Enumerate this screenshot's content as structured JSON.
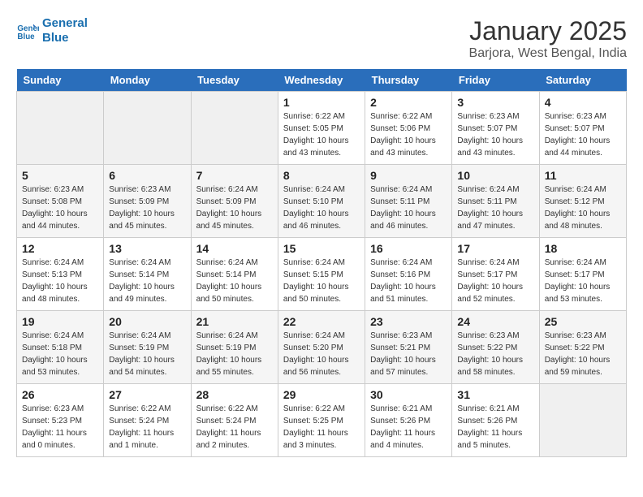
{
  "header": {
    "logo_line1": "General",
    "logo_line2": "Blue",
    "title": "January 2025",
    "subtitle": "Barjora, West Bengal, India"
  },
  "weekdays": [
    "Sunday",
    "Monday",
    "Tuesday",
    "Wednesday",
    "Thursday",
    "Friday",
    "Saturday"
  ],
  "weeks": [
    [
      {
        "day": "",
        "info": ""
      },
      {
        "day": "",
        "info": ""
      },
      {
        "day": "",
        "info": ""
      },
      {
        "day": "1",
        "info": "Sunrise: 6:22 AM\nSunset: 5:05 PM\nDaylight: 10 hours\nand 43 minutes."
      },
      {
        "day": "2",
        "info": "Sunrise: 6:22 AM\nSunset: 5:06 PM\nDaylight: 10 hours\nand 43 minutes."
      },
      {
        "day": "3",
        "info": "Sunrise: 6:23 AM\nSunset: 5:07 PM\nDaylight: 10 hours\nand 43 minutes."
      },
      {
        "day": "4",
        "info": "Sunrise: 6:23 AM\nSunset: 5:07 PM\nDaylight: 10 hours\nand 44 minutes."
      }
    ],
    [
      {
        "day": "5",
        "info": "Sunrise: 6:23 AM\nSunset: 5:08 PM\nDaylight: 10 hours\nand 44 minutes."
      },
      {
        "day": "6",
        "info": "Sunrise: 6:23 AM\nSunset: 5:09 PM\nDaylight: 10 hours\nand 45 minutes."
      },
      {
        "day": "7",
        "info": "Sunrise: 6:24 AM\nSunset: 5:09 PM\nDaylight: 10 hours\nand 45 minutes."
      },
      {
        "day": "8",
        "info": "Sunrise: 6:24 AM\nSunset: 5:10 PM\nDaylight: 10 hours\nand 46 minutes."
      },
      {
        "day": "9",
        "info": "Sunrise: 6:24 AM\nSunset: 5:11 PM\nDaylight: 10 hours\nand 46 minutes."
      },
      {
        "day": "10",
        "info": "Sunrise: 6:24 AM\nSunset: 5:11 PM\nDaylight: 10 hours\nand 47 minutes."
      },
      {
        "day": "11",
        "info": "Sunrise: 6:24 AM\nSunset: 5:12 PM\nDaylight: 10 hours\nand 48 minutes."
      }
    ],
    [
      {
        "day": "12",
        "info": "Sunrise: 6:24 AM\nSunset: 5:13 PM\nDaylight: 10 hours\nand 48 minutes."
      },
      {
        "day": "13",
        "info": "Sunrise: 6:24 AM\nSunset: 5:14 PM\nDaylight: 10 hours\nand 49 minutes."
      },
      {
        "day": "14",
        "info": "Sunrise: 6:24 AM\nSunset: 5:14 PM\nDaylight: 10 hours\nand 50 minutes."
      },
      {
        "day": "15",
        "info": "Sunrise: 6:24 AM\nSunset: 5:15 PM\nDaylight: 10 hours\nand 50 minutes."
      },
      {
        "day": "16",
        "info": "Sunrise: 6:24 AM\nSunset: 5:16 PM\nDaylight: 10 hours\nand 51 minutes."
      },
      {
        "day": "17",
        "info": "Sunrise: 6:24 AM\nSunset: 5:17 PM\nDaylight: 10 hours\nand 52 minutes."
      },
      {
        "day": "18",
        "info": "Sunrise: 6:24 AM\nSunset: 5:17 PM\nDaylight: 10 hours\nand 53 minutes."
      }
    ],
    [
      {
        "day": "19",
        "info": "Sunrise: 6:24 AM\nSunset: 5:18 PM\nDaylight: 10 hours\nand 53 minutes."
      },
      {
        "day": "20",
        "info": "Sunrise: 6:24 AM\nSunset: 5:19 PM\nDaylight: 10 hours\nand 54 minutes."
      },
      {
        "day": "21",
        "info": "Sunrise: 6:24 AM\nSunset: 5:19 PM\nDaylight: 10 hours\nand 55 minutes."
      },
      {
        "day": "22",
        "info": "Sunrise: 6:24 AM\nSunset: 5:20 PM\nDaylight: 10 hours\nand 56 minutes."
      },
      {
        "day": "23",
        "info": "Sunrise: 6:23 AM\nSunset: 5:21 PM\nDaylight: 10 hours\nand 57 minutes."
      },
      {
        "day": "24",
        "info": "Sunrise: 6:23 AM\nSunset: 5:22 PM\nDaylight: 10 hours\nand 58 minutes."
      },
      {
        "day": "25",
        "info": "Sunrise: 6:23 AM\nSunset: 5:22 PM\nDaylight: 10 hours\nand 59 minutes."
      }
    ],
    [
      {
        "day": "26",
        "info": "Sunrise: 6:23 AM\nSunset: 5:23 PM\nDaylight: 11 hours\nand 0 minutes."
      },
      {
        "day": "27",
        "info": "Sunrise: 6:22 AM\nSunset: 5:24 PM\nDaylight: 11 hours\nand 1 minute."
      },
      {
        "day": "28",
        "info": "Sunrise: 6:22 AM\nSunset: 5:24 PM\nDaylight: 11 hours\nand 2 minutes."
      },
      {
        "day": "29",
        "info": "Sunrise: 6:22 AM\nSunset: 5:25 PM\nDaylight: 11 hours\nand 3 minutes."
      },
      {
        "day": "30",
        "info": "Sunrise: 6:21 AM\nSunset: 5:26 PM\nDaylight: 11 hours\nand 4 minutes."
      },
      {
        "day": "31",
        "info": "Sunrise: 6:21 AM\nSunset: 5:26 PM\nDaylight: 11 hours\nand 5 minutes."
      },
      {
        "day": "",
        "info": ""
      }
    ]
  ]
}
